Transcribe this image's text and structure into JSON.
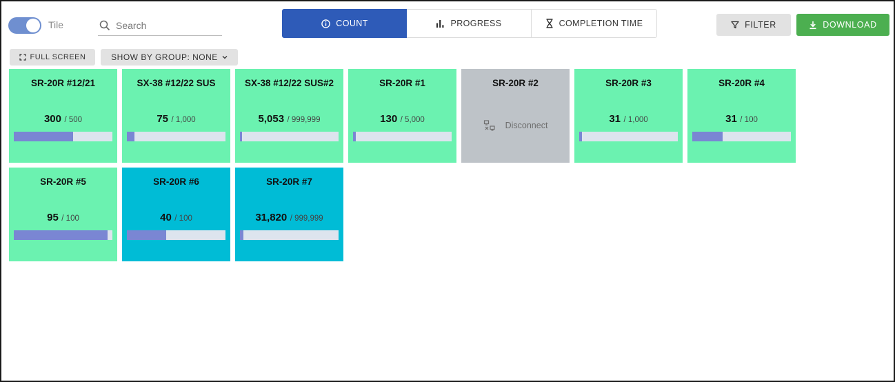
{
  "toolbar": {
    "toggle_label": "Tile",
    "search_placeholder": "Search",
    "tabs": [
      {
        "label": "COUNT",
        "icon": "info-circle-icon",
        "active": true
      },
      {
        "label": "PROGRESS",
        "icon": "bar-chart-icon",
        "active": false
      },
      {
        "label": "COMPLETION TIME",
        "icon": "hourglass-icon",
        "active": false
      }
    ],
    "filter_label": "FILTER",
    "download_label": "DOWNLOAD",
    "fullscreen_label": "FULL SCREEN",
    "group_label": "SHOW BY GROUP: NONE"
  },
  "colors": {
    "active_tab": "#2e5bb8",
    "download": "#4caf50",
    "tile_green": "#6bf2b0",
    "tile_cyan": "#00bcd6",
    "tile_grey": "#bec3c8",
    "progress_fill": "#7a86d3"
  },
  "tiles": [
    {
      "name": "SR-20R #12/21",
      "current": "300",
      "total": "/ 500",
      "progress": 0.6,
      "color": "green"
    },
    {
      "name": "SX-38 #12/22 SUS",
      "current": "75",
      "total": "/ 1,000",
      "progress": 0.075,
      "color": "green"
    },
    {
      "name": "SX-38 #12/22 SUS#2",
      "current": "5,053",
      "total": "/ 999,999",
      "progress": 0.005,
      "color": "green"
    },
    {
      "name": "SR-20R #1",
      "current": "130",
      "total": "/ 5,000",
      "progress": 0.026,
      "color": "green"
    },
    {
      "name": "SR-20R #2",
      "status": "Disconnect",
      "color": "grey"
    },
    {
      "name": "SR-20R #3",
      "current": "31",
      "total": "/ 1,000",
      "progress": 0.031,
      "color": "green"
    },
    {
      "name": "SR-20R #4",
      "current": "31",
      "total": "/ 100",
      "progress": 0.31,
      "color": "green"
    },
    {
      "name": "SR-20R #5",
      "current": "95",
      "total": "/ 100",
      "progress": 0.95,
      "color": "green"
    },
    {
      "name": "SR-20R #6",
      "current": "40",
      "total": "/ 100",
      "progress": 0.4,
      "color": "cyan"
    },
    {
      "name": "SR-20R #7",
      "current": "31,820",
      "total": "/ 999,999",
      "progress": 0.032,
      "color": "cyan"
    }
  ]
}
